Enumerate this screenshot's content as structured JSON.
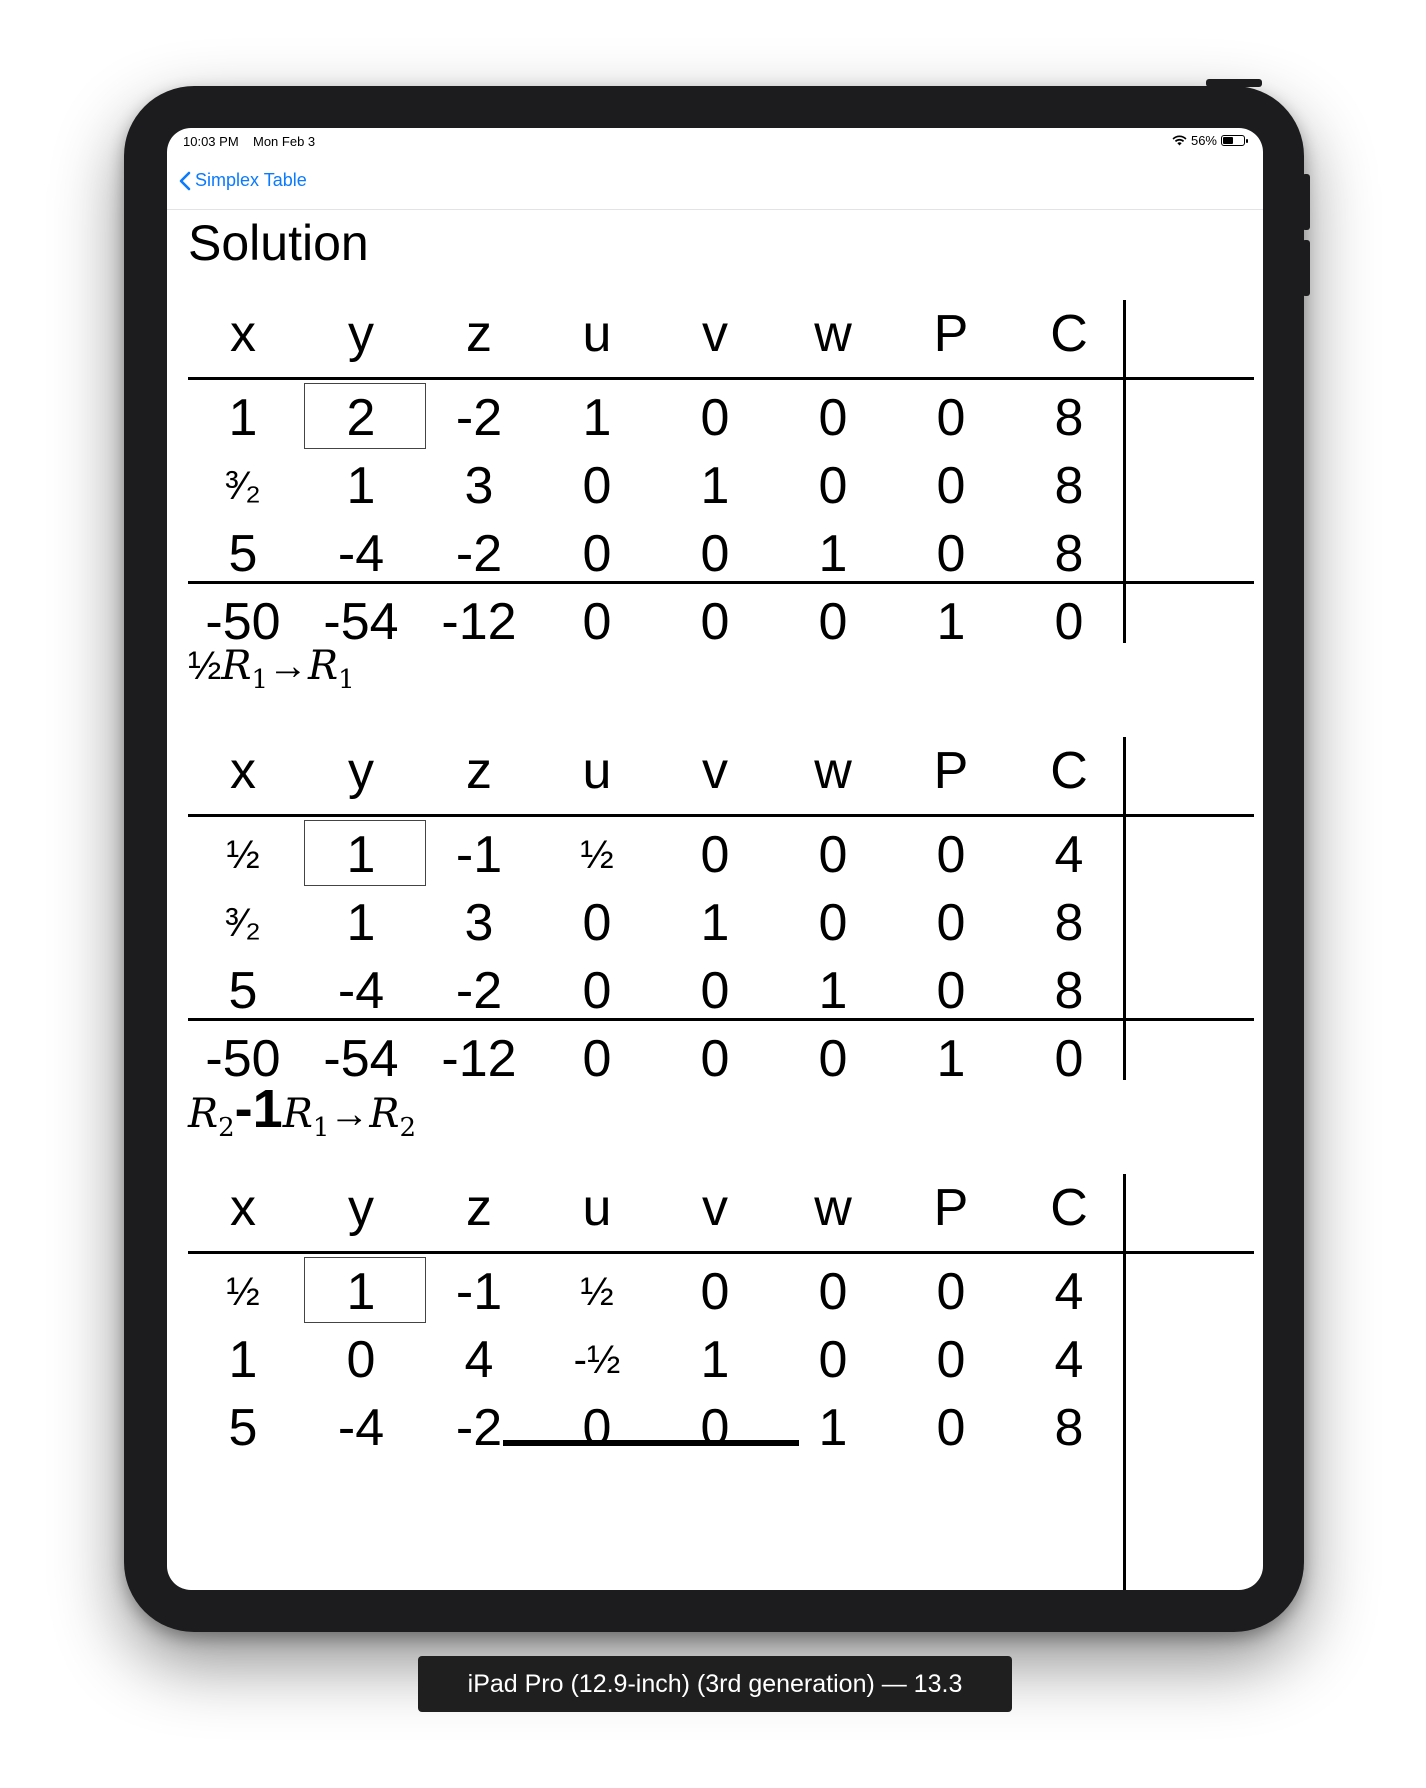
{
  "status_bar": {
    "time": "10:03 PM",
    "date": "Mon Feb 3",
    "battery": "56%",
    "battery_level": 0.56,
    "wifi_icon": "wifi-icon"
  },
  "nav": {
    "back_label": "Simplex Table",
    "back_icon": "chevron-left-icon"
  },
  "page": {
    "title": "Solution"
  },
  "tableaux": [
    {
      "headers": [
        "x",
        "y",
        "z",
        "u",
        "v",
        "w",
        "P",
        "C"
      ],
      "rows": [
        [
          "1",
          "2",
          "-2",
          "1",
          "0",
          "0",
          "0",
          "8"
        ],
        [
          "³⁄₂",
          "1",
          "3",
          "0",
          "1",
          "0",
          "0",
          "8"
        ],
        [
          "5",
          "-4",
          "-2",
          "0",
          "0",
          "1",
          "0",
          "8"
        ],
        [
          "-50",
          "-54",
          "-12",
          "0",
          "0",
          "0",
          "1",
          "0"
        ]
      ]
    },
    {
      "headers": [
        "x",
        "y",
        "z",
        "u",
        "v",
        "w",
        "P",
        "C"
      ],
      "rows": [
        [
          "½",
          "1",
          "-1",
          "½",
          "0",
          "0",
          "0",
          "4"
        ],
        [
          "³⁄₂",
          "1",
          "3",
          "0",
          "1",
          "0",
          "0",
          "8"
        ],
        [
          "5",
          "-4",
          "-2",
          "0",
          "0",
          "1",
          "0",
          "8"
        ],
        [
          "-50",
          "-54",
          "-12",
          "0",
          "0",
          "0",
          "1",
          "0"
        ]
      ]
    },
    {
      "headers": [
        "x",
        "y",
        "z",
        "u",
        "v",
        "w",
        "P",
        "C"
      ],
      "rows": [
        [
          "½",
          "1",
          "-1",
          "½",
          "0",
          "0",
          "0",
          "4"
        ],
        [
          "1",
          "0",
          "4",
          "-½",
          "1",
          "0",
          "0",
          "4"
        ],
        [
          "5",
          "-4",
          "-2",
          "0",
          "0",
          "1",
          "0",
          "8"
        ]
      ]
    }
  ],
  "operations": [
    {
      "coef": "½",
      "lhs_letter": "R",
      "lhs_index": "1",
      "arrow": "→",
      "rhs_letter": "R",
      "rhs_index": "1"
    },
    {
      "a_letter": "R",
      "a_index": "2",
      "minus": "-",
      "coef": "1",
      "b_letter": "R",
      "b_index": "1",
      "arrow": "→",
      "rhs_letter": "R",
      "rhs_index": "2"
    }
  ],
  "device_label": "iPad Pro (12.9-inch) (3rd generation) — 13.3"
}
